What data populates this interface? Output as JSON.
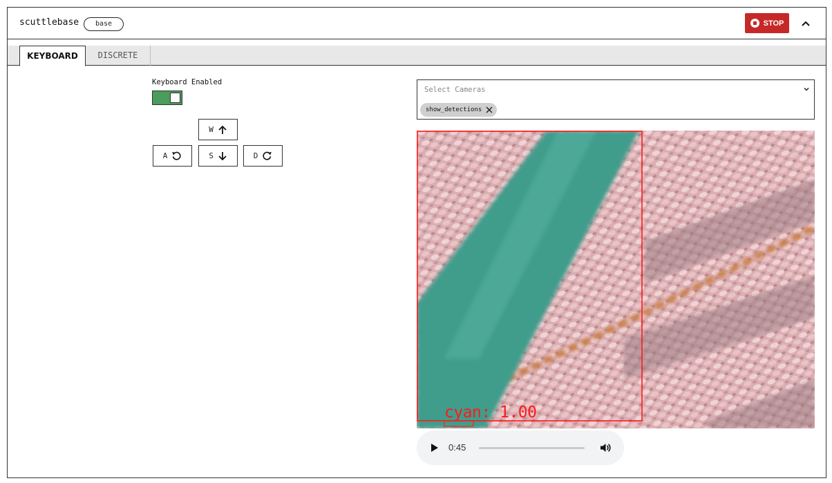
{
  "header": {
    "title": "scuttlebase",
    "badge": "base",
    "stop_label": "STOP",
    "stop_color": "#c62828"
  },
  "tabs": [
    {
      "label": "KEYBOARD",
      "active": true
    },
    {
      "label": "DISCRETE",
      "active": false
    }
  ],
  "keyboard": {
    "enabled_label": "Keyboard Enabled",
    "enabled": true,
    "toggle_color": "#4a9d5a",
    "keys": {
      "w": {
        "label": "W",
        "icon": "arrow-up-icon"
      },
      "a": {
        "label": "A",
        "icon": "rotate-left-icon"
      },
      "s": {
        "label": "S",
        "icon": "arrow-down-icon"
      },
      "d": {
        "label": "D",
        "icon": "rotate-right-icon"
      }
    }
  },
  "cameras": {
    "placeholder": "Select Cameras",
    "selected": [
      "show_detections"
    ]
  },
  "video": {
    "detection_label": "cyan: 1.00",
    "detection_color": "#ff1a1a"
  },
  "player": {
    "time": "0:45"
  }
}
